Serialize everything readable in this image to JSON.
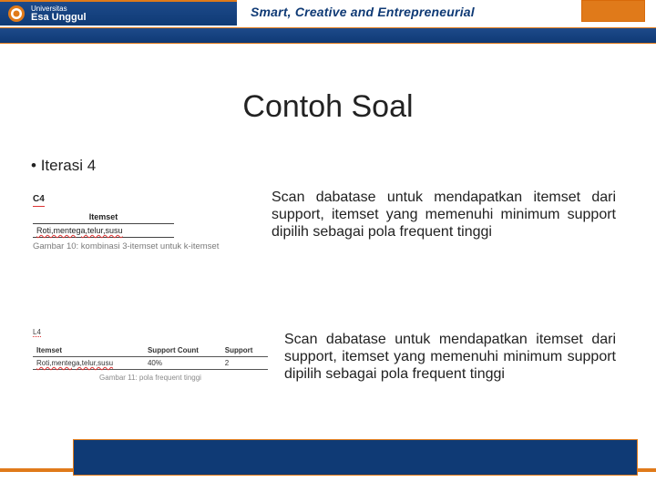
{
  "colors": {
    "accent_blue": "#0f3a75",
    "accent_orange": "#e07a1a"
  },
  "header": {
    "logo_small": "Universitas",
    "logo_main": "Esa Unggul",
    "tagline": "Smart, Creative and Entrepreneurial"
  },
  "title": "Contoh Soal",
  "bullet": "Iterasi 4",
  "figure1": {
    "label": "C4",
    "th": "Itemset",
    "row": "Roti,mentega,telur,susu",
    "caption": "Gambar 10: kombinasi 3-itemset untuk k-itemset"
  },
  "paragraph1": "Scan dabatase untuk mendapatkan itemset dari support, itemset yang memenuhi minimum support dipilih sebagai pola frequent tinggi",
  "figure2": {
    "label": "L4",
    "headers": [
      "Itemset",
      "Support Count",
      "Support"
    ],
    "row": [
      "Roti,mentega,telur,susu",
      "40%",
      "2"
    ],
    "caption": "Gambar 11: pola frequent tinggi"
  },
  "paragraph2": "Scan dabatase untuk mendapatkan itemset dari support, itemset yang memenuhi minimum support dipilih sebagai pola frequent tinggi"
}
